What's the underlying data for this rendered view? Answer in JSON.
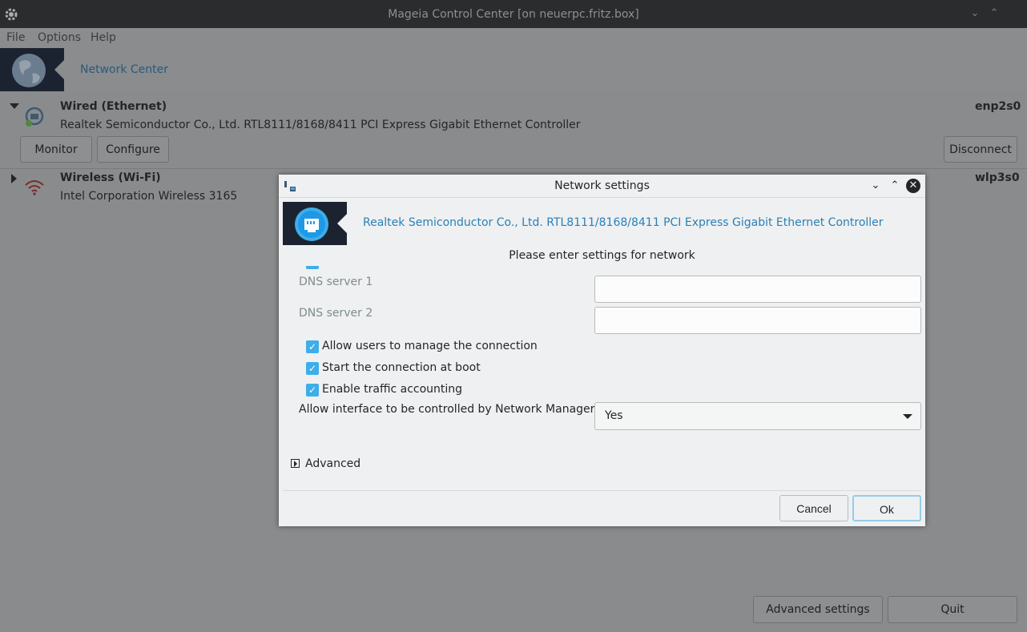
{
  "window": {
    "title": "Mageia Control Center [on neuerpc.fritz.box]",
    "controls": [
      "minimize",
      "maximize"
    ]
  },
  "menubar": {
    "items": [
      "File",
      "Options",
      "Help"
    ]
  },
  "header": {
    "title": "Network Center"
  },
  "interfaces": [
    {
      "type": "Wired (Ethernet)",
      "description": "Realtek Semiconductor Co., Ltd. RTL8111/8168/8411 PCI Express Gigabit Ethernet Controller",
      "device": "enp2s0",
      "expanded": true,
      "buttons": {
        "monitor": "Monitor",
        "configure": "Configure",
        "disconnect": "Disconnect"
      }
    },
    {
      "type": "Wireless (Wi-Fi)",
      "description": "Intel Corporation Wireless 3165",
      "device": "wlp3s0",
      "expanded": false
    }
  ],
  "footer": {
    "advanced_settings": "Advanced settings",
    "quit": "Quit"
  },
  "dialog": {
    "title": "Network settings",
    "header_text": "Realtek Semiconductor Co., Ltd. RTL8111/8168/8411 PCI Express Gigabit Ethernet Controller",
    "prompt": "Please enter settings for network",
    "dns1": {
      "label": "DNS server 1",
      "value": ""
    },
    "dns2": {
      "label": "DNS server 2",
      "value": ""
    },
    "checkboxes": [
      {
        "label": "Allow users to manage the connection",
        "checked": true
      },
      {
        "label": "Start the connection at boot",
        "checked": true
      },
      {
        "label": "Enable traffic accounting",
        "checked": true
      }
    ],
    "nm_control": {
      "label": "Allow interface to be controlled by Network Manager",
      "value": "Yes"
    },
    "advanced": "Advanced",
    "cancel": "Cancel",
    "ok": "Ok"
  },
  "colors": {
    "accent": "#3daee9",
    "link_text": "#2980b9",
    "titlebar": "#2b2c2e",
    "header_icon_bg": "#1c2330"
  }
}
